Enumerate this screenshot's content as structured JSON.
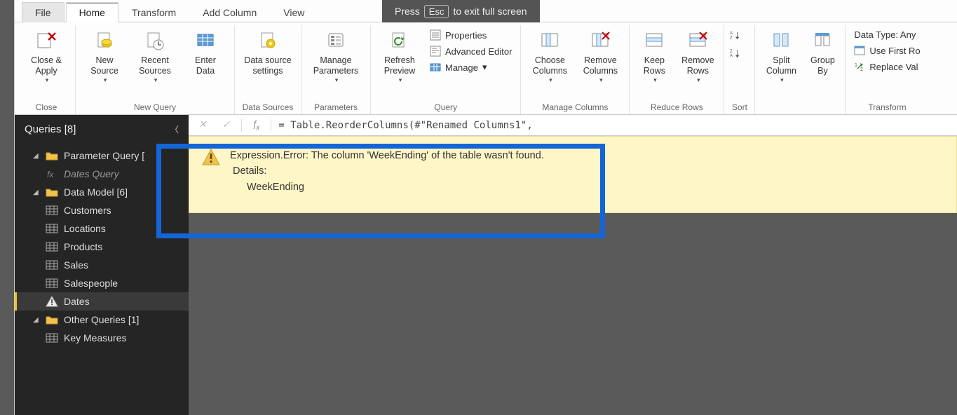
{
  "fs_banner": {
    "pre": "Press",
    "key": "Esc",
    "post": "to exit full screen"
  },
  "tabs": {
    "file": "File",
    "home": "Home",
    "transform": "Transform",
    "add_column": "Add Column",
    "view": "View"
  },
  "ribbon": {
    "close": {
      "close_apply": "Close &\nApply",
      "group": "Close"
    },
    "new_query": {
      "new_source": "New\nSource",
      "recent_sources": "Recent\nSources",
      "enter_data": "Enter\nData",
      "group": "New Query"
    },
    "data_sources": {
      "settings": "Data source\nsettings",
      "group": "Data Sources"
    },
    "parameters": {
      "manage": "Manage\nParameters",
      "group": "Parameters"
    },
    "query": {
      "refresh": "Refresh\nPreview",
      "properties": "Properties",
      "advanced": "Advanced Editor",
      "manage": "Manage",
      "group": "Query"
    },
    "manage_columns": {
      "choose": "Choose\nColumns",
      "remove": "Remove\nColumns",
      "group": "Manage Columns"
    },
    "reduce_rows": {
      "keep": "Keep\nRows",
      "remove": "Remove\nRows",
      "group": "Reduce Rows"
    },
    "sort": {
      "group": "Sort"
    },
    "split_group": {
      "split": "Split\nColumn",
      "groupby": "Group\nBy"
    },
    "transform": {
      "data_type": "Data Type: Any",
      "first_row": "Use First Ro",
      "replace": "Replace Val",
      "group": "Transform"
    }
  },
  "sidebar": {
    "title": "Queries [8]",
    "groups": [
      {
        "label": "Parameter Query [",
        "icon": "folder",
        "children": [
          {
            "label": "Dates Query",
            "icon": "fx",
            "italic": true
          }
        ]
      },
      {
        "label": "Data Model [6]",
        "icon": "folder",
        "children": [
          {
            "label": "Customers",
            "icon": "table"
          },
          {
            "label": "Locations",
            "icon": "table"
          },
          {
            "label": "Products",
            "icon": "table"
          },
          {
            "label": "Sales",
            "icon": "table"
          },
          {
            "label": "Salespeople",
            "icon": "table"
          },
          {
            "label": "Dates",
            "icon": "warning",
            "selected": true
          }
        ]
      },
      {
        "label": "Other Queries [1]",
        "icon": "folder",
        "children": [
          {
            "label": "Key Measures",
            "icon": "table"
          }
        ]
      }
    ]
  },
  "formula": "= Table.ReorderColumns(#\"Renamed Columns1\",",
  "error": {
    "message": "Expression.Error: The column 'WeekEnding' of the table wasn't found.",
    "details_label": "Details:",
    "details_value": "WeekEnding"
  }
}
